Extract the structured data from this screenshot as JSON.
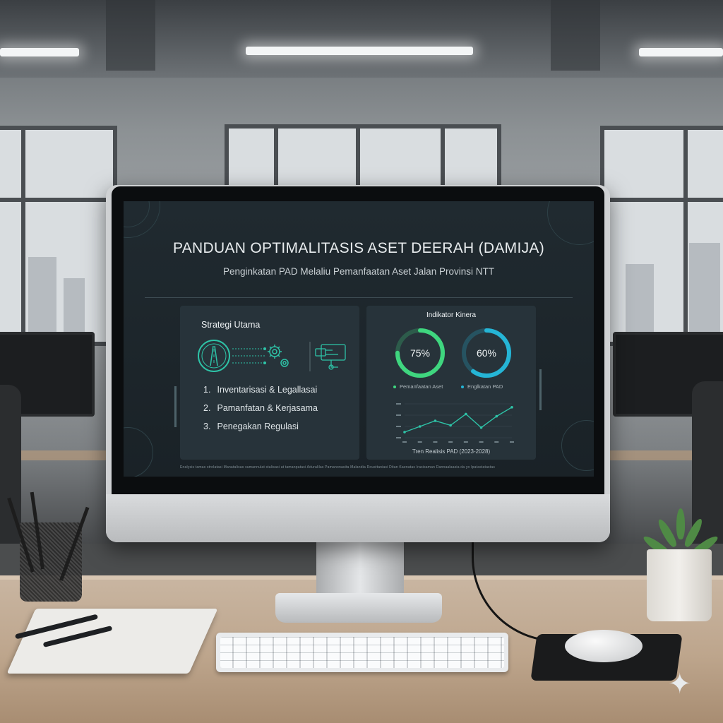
{
  "slide": {
    "title": "PANDUAN OPTIMALITASIS ASET DEERAH (DAMIJA)",
    "subtitle": "Penginkatan PAD Melaliu Pemanfaatan Aset Jalan Provinsi NTT",
    "footnote": "Enalysis tamas strolatasi Manatalisas sumannulat stalisasi at tamanpatasi Aduralilas Pamanonasita Malandia Rousttaniasi Ditan Kaenatas Irasisaman Dannaalaasia da yo Ipatastatastas"
  },
  "strategy": {
    "heading": "Strategi Utama",
    "items": [
      {
        "num": "1.",
        "label": "Inventarisasi & Legallasai"
      },
      {
        "num": "2.",
        "label": "Pamanfatan & Kerjasama"
      },
      {
        "num": "3.",
        "label": "Penegakan Regulasi"
      }
    ]
  },
  "indicators": {
    "heading": "Indikator Kinera",
    "gauges": [
      {
        "value_text": "75%",
        "fraction": 0.75,
        "label": "Pemanfaatan Aset",
        "color": "#3fd67f"
      },
      {
        "value_text": "60%",
        "fraction": 0.6,
        "label": "Englkatan PAD",
        "color": "#25b5d6"
      }
    ],
    "chart_caption": "Tren Realisis PAD (2023-2028)"
  },
  "chart_data": {
    "type": "line",
    "title": "",
    "x": [
      1,
      2,
      3,
      4,
      5,
      6,
      7,
      8
    ],
    "series": [
      {
        "values": [
          2.0,
          2.5,
          3.0,
          2.6,
          3.6,
          2.4,
          3.4,
          4.2
        ]
      }
    ],
    "ylim": [
      1.5,
      4.5
    ],
    "grid": true
  },
  "colors": {
    "accent_teal": "#2ec4a8",
    "gauge_green": "#3fd67f",
    "gauge_blue": "#25b5d6",
    "slide_bg": "#1e272c",
    "panel_bg": "#27333a"
  },
  "icons": [
    "road-icon",
    "gears-icon",
    "contract-icon"
  ]
}
